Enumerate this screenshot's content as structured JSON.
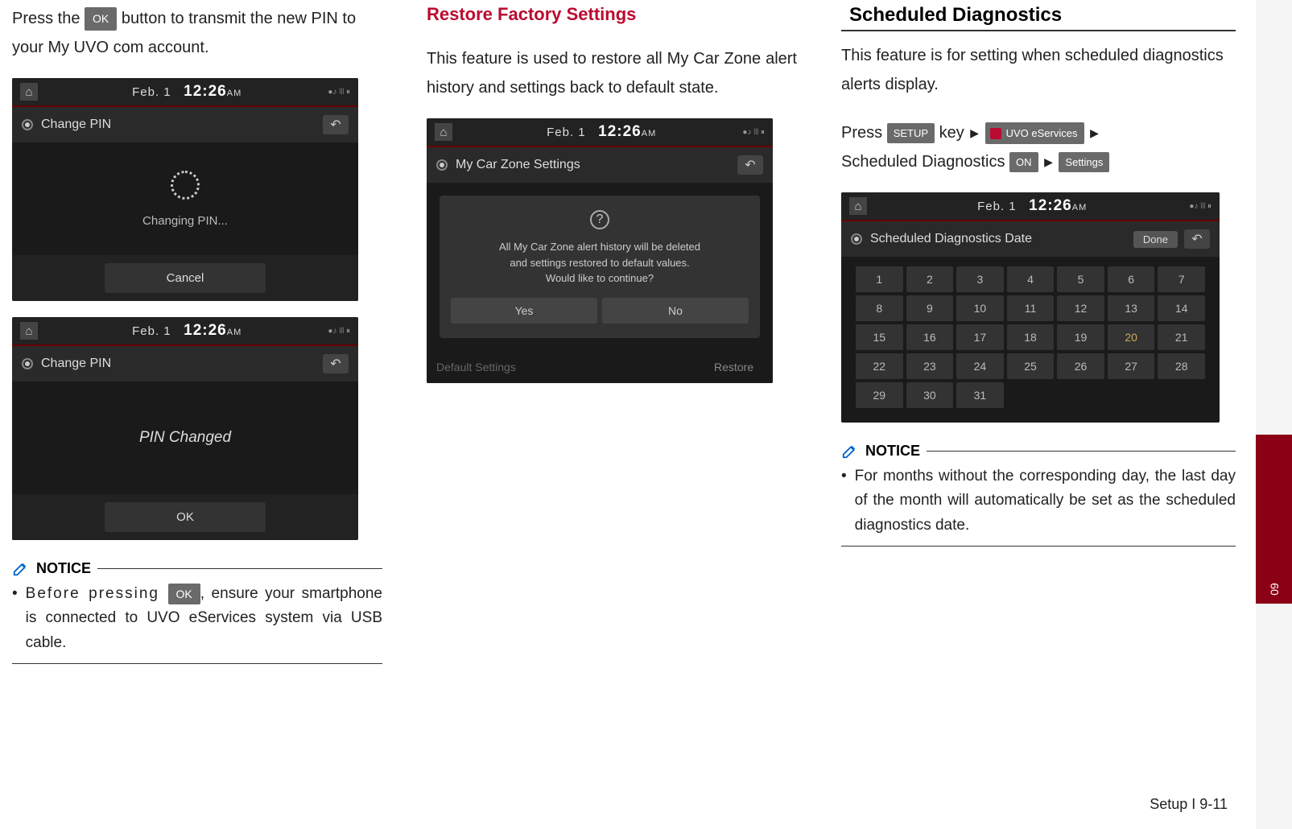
{
  "col1": {
    "intro_part1": "Press the ",
    "btn_ok": "OK",
    "intro_part2": " button to transmit the new PIN to your My UVO com account.",
    "ss1": {
      "date_prefix": "Feb.  1",
      "time": "12:26",
      "ampm": "AM",
      "status": "●♪ ꔖ ⏸",
      "title": "Change PIN",
      "body": "Changing PIN...",
      "footer_btn": "Cancel"
    },
    "ss2": {
      "date_prefix": "Feb.  1",
      "time": "12:26",
      "ampm": "AM",
      "status": "●♪ ꔖ ⏸",
      "title": "Change PIN",
      "body": "PIN Changed",
      "footer_btn": "OK"
    },
    "notice_label": "NOTICE",
    "notice_p1": "Before pressing ",
    "notice_ok": "OK",
    "notice_p2": ", ensure your smartphone is connected to UVO eServices system via USB cable."
  },
  "col2": {
    "heading": "Restore Factory Settings",
    "body": "This feature is used to restore all My Car Zone alert history and settings back to default state.",
    "ss": {
      "date_prefix": "Feb.  1",
      "time": "12:26",
      "ampm": "AM",
      "status": "●♪ ꔖ ⏸",
      "title": "My Car Zone Settings",
      "modal_line1": "All My Car Zone alert history will be deleted",
      "modal_line2": "and settings restored to default values.",
      "modal_line3": "Would like to continue?",
      "yes": "Yes",
      "no": "No",
      "bottom_label": "Default Settings",
      "bottom_btn": "Restore"
    }
  },
  "col3": {
    "heading": "Scheduled Diagnostics",
    "body": "This feature is for setting when scheduled diagnostics alerts display.",
    "steps": {
      "p1": "Press ",
      "b1": "SETUP",
      "p2": " key ",
      "b2": "UVO eServices",
      "p3": " Scheduled Diagnostics ",
      "b3": "ON",
      "b4": "Settings"
    },
    "ss": {
      "date_prefix": "Feb.  1",
      "time": "12:26",
      "ampm": "AM",
      "status": "●♪ ꔖ ⏸",
      "title": "Scheduled Diagnostics Date",
      "done": "Done",
      "days": [
        "1",
        "2",
        "3",
        "4",
        "5",
        "6",
        "7",
        "8",
        "9",
        "10",
        "11",
        "12",
        "13",
        "14",
        "15",
        "16",
        "17",
        "18",
        "19",
        "20",
        "21",
        "22",
        "23",
        "24",
        "25",
        "26",
        "27",
        "28",
        "29",
        "30",
        "31"
      ],
      "selected": 20
    },
    "notice_label": "NOTICE",
    "notice_text": "For months without the corresponding day, the last day of the month will automatically  be set as the scheduled diagnostics date."
  },
  "footer": "Setup I 9-11",
  "tab": "09"
}
